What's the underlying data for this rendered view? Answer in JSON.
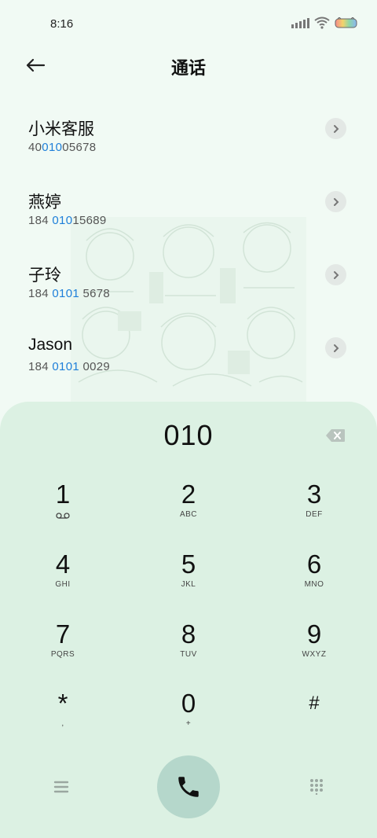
{
  "status_bar": {
    "time": "8:16"
  },
  "header": {
    "title": "通话"
  },
  "contacts": [
    {
      "name": "小米客服",
      "number_pre": "40",
      "number_match": "010",
      "number_post": "05678"
    },
    {
      "name": "燕婷",
      "number_pre": "184 ",
      "number_match": "010",
      "number_post": "15689"
    },
    {
      "name": "子玲",
      "number_pre": "184 ",
      "number_match": "0101",
      "number_post": " 5678"
    },
    {
      "name": "Jason",
      "number_pre": "184 ",
      "number_match": "0101",
      "number_post": " 0029"
    }
  ],
  "dialer": {
    "input": "010",
    "keys": [
      {
        "digit": "1",
        "letters": ""
      },
      {
        "digit": "2",
        "letters": "ABC"
      },
      {
        "digit": "3",
        "letters": "DEF"
      },
      {
        "digit": "4",
        "letters": "GHI"
      },
      {
        "digit": "5",
        "letters": "JKL"
      },
      {
        "digit": "6",
        "letters": "MNO"
      },
      {
        "digit": "7",
        "letters": "PQRS"
      },
      {
        "digit": "8",
        "letters": "TUV"
      },
      {
        "digit": "9",
        "letters": "WXYZ"
      },
      {
        "digit": "*",
        "letters": ","
      },
      {
        "digit": "0",
        "letters": "+"
      },
      {
        "digit": "#",
        "letters": ""
      }
    ]
  },
  "colors": {
    "background": "#f1faf4",
    "dialer_panel": "#dcf1e3",
    "call_button": "#b5d7cb",
    "match_highlight": "#1e7fd9"
  },
  "icons": {
    "back": "arrow-left-icon",
    "chevron": "chevron-right-icon",
    "backspace": "backspace-icon",
    "voicemail": "voicemail-icon",
    "menu": "menu-icon",
    "call": "phone-icon",
    "keypad": "keypad-grid-icon"
  }
}
